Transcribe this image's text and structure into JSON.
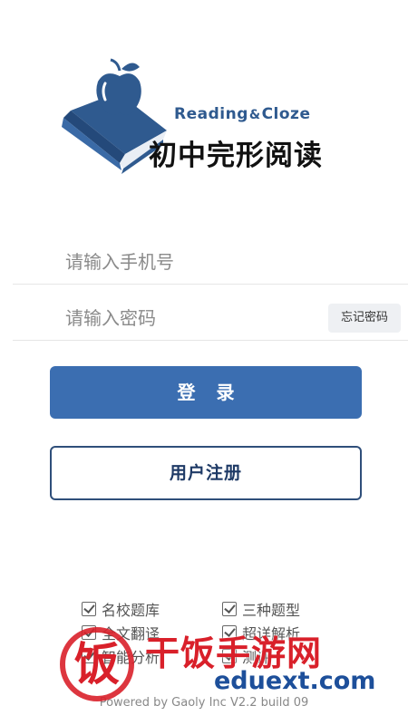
{
  "logo": {
    "title_en_left": "Reading",
    "title_en_amp": "&",
    "title_en_right": "Cloze",
    "title_cn": "初中完形阅读",
    "brand_color": "#2f5a8f"
  },
  "login_form": {
    "phone_placeholder": "请输入手机号",
    "password_placeholder": "请输入密码",
    "forgot_password_label": "忘记密码",
    "login_label": "登 录",
    "register_label": "用户注册"
  },
  "features": [
    {
      "label": "名校题库",
      "checked": true
    },
    {
      "label": "三种题型",
      "checked": true
    },
    {
      "label": "全文翻译",
      "checked": true
    },
    {
      "label": "超详解析",
      "checked": true
    },
    {
      "label": "智能分析",
      "checked": true
    },
    {
      "label": "测评",
      "checked": true
    }
  ],
  "footer": {
    "powered_by": "Powered by Gaoly Inc V2.2 build 09"
  },
  "watermark": {
    "site_name": "干饭手游网",
    "site_url": "eduext.com",
    "icon_char": "饭",
    "colors": {
      "red": "#d9202a",
      "blue": "#1d4f9a"
    }
  },
  "colors": {
    "primary": "#3b6eb1",
    "register_border": "#2f4f7a",
    "forgot_bg": "#eef0f3"
  }
}
